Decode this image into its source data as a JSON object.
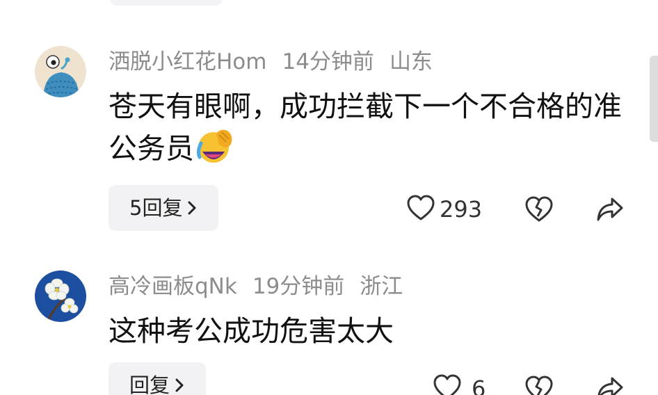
{
  "comments": [
    {
      "username": "洒脱小红花Hom",
      "time": "14分钟前",
      "location": "山东",
      "text": "苍天有眼啊，成功拦截下一个不合格的准公务员",
      "reply_label": "5回复",
      "like_count": "293",
      "avatar_icon": "alien-cartoon-avatar",
      "emoji_icon": "laughing-crying-emoji"
    },
    {
      "username": "高冷画板qNk",
      "time": "19分钟前",
      "location": "浙江",
      "text": "这种考公成功危害太大",
      "reply_label": "回复",
      "like_count": "6",
      "avatar_icon": "white-flower-avatar"
    }
  ],
  "icons": {
    "like": "heart-outline-icon",
    "dislike": "broken-heart-icon",
    "share": "share-arrow-icon",
    "chevron": "chevron-right-icon"
  }
}
